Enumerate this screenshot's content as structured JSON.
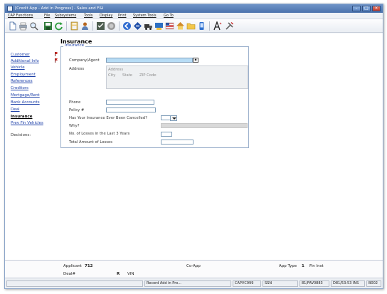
{
  "window": {
    "title": "[Credit App - Add in Progress] - Sales and F&I",
    "controls": {
      "minimize": "–",
      "maximize": "□",
      "close": "×"
    }
  },
  "menu": [
    "CAP Functions",
    "File",
    "Subsystems",
    "Tools",
    "Display",
    "Print",
    "System Tools",
    "Go To"
  ],
  "toolbar": {
    "icons": [
      "new-icon",
      "print-icon",
      "zoom-icon",
      "save-icon",
      "refresh-icon",
      "calculator-icon",
      "person-icon",
      "checklist-icon",
      "globe-icon",
      "arrow-left-icon",
      "arrow-right-icon",
      "truck-icon",
      "keyboard-icon",
      "flag-icon",
      "house-icon",
      "folder-icon",
      "phone-icon",
      "font-icon",
      "tools-icon"
    ]
  },
  "nav": {
    "items": [
      {
        "label": "Customer",
        "flag": true
      },
      {
        "label": "Additional Info",
        "flag": true
      },
      {
        "label": "Vehicle",
        "flag": false
      },
      {
        "label": "Employment",
        "flag": false
      },
      {
        "label": "References",
        "flag": false
      },
      {
        "label": "Creditors",
        "flag": false
      },
      {
        "label": "Mortgage/Rent",
        "flag": false
      },
      {
        "label": "Bank Accounts",
        "flag": false
      },
      {
        "label": "Deal",
        "flag": false
      },
      {
        "label": "Insurance",
        "flag": false,
        "current": true
      },
      {
        "label": "Prev Fin Vehicles",
        "flag": false
      }
    ],
    "decisions_label": "Decisions:"
  },
  "form": {
    "page_title": "Insurance",
    "group_title": "Insurance",
    "company_agent_label": "Company/Agent",
    "lookup_button": "▪",
    "address_label": "Address",
    "address_placeholder": "Address",
    "city_placeholder": "City",
    "state_placeholder": "State",
    "zip_placeholder": "ZIP Code",
    "phone_label": "Phone",
    "policy_label": "Policy #",
    "cancelled_label": "Has Your Insurance Ever Been Cancelled?",
    "why_label": "Why?",
    "losses_count_label": "No. of Losses in the Last 3 Years",
    "losses_amount_label": "Total Amount of Losses"
  },
  "footer": {
    "applicant_label": "Applicant",
    "applicant_value": "712",
    "coapp_label": "Co-App",
    "app_type_label": "App Type",
    "app_type_value": "1",
    "fin_inst_label": "Fin Inst",
    "deal_label": "Deal#",
    "deal_flag": "R",
    "vin_label": "VIN"
  },
  "status": {
    "mode": "Record Add in Pro...",
    "form_code": "CAPVC999",
    "user": "SSN",
    "session": "81/FAV0883",
    "time": "D81/53:53 INS",
    "code": "B002"
  },
  "colors": {
    "required_field": "#b7dcf5",
    "disabled_field": "#d9d9d9",
    "link": "#1c3fa8",
    "titlebar": "#4a72ad",
    "flag": "#d0342c"
  }
}
